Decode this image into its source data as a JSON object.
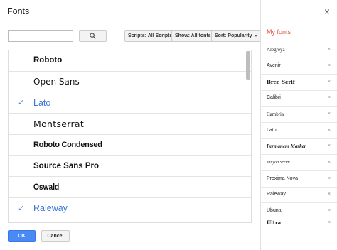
{
  "dialog": {
    "title": "Fonts",
    "close_icon": "×"
  },
  "search": {
    "value": "",
    "placeholder": ""
  },
  "filters": [
    {
      "label": "Scripts: All Scripts"
    },
    {
      "label": "Show: All fonts"
    },
    {
      "label": "Sort: Popularity"
    }
  ],
  "fonts": [
    {
      "name": "Roboto",
      "selected": false
    },
    {
      "name": "Open Sans",
      "selected": false
    },
    {
      "name": "Lato",
      "selected": true
    },
    {
      "name": "Montserrat",
      "selected": false
    },
    {
      "name": "Roboto Condensed",
      "selected": false
    },
    {
      "name": "Source Sans Pro",
      "selected": false
    },
    {
      "name": "Oswald",
      "selected": false
    },
    {
      "name": "Raleway",
      "selected": true
    }
  ],
  "check_icon": "✓",
  "my_fonts": {
    "title": "My fonts",
    "items": [
      {
        "name": "Alegreya"
      },
      {
        "name": "Avenir"
      },
      {
        "name": "Bree Serif"
      },
      {
        "name": "Calibri"
      },
      {
        "name": "Cambria"
      },
      {
        "name": "Lato"
      },
      {
        "name": "Permanent Marker"
      },
      {
        "name": "Pinyon Script"
      },
      {
        "name": "Proxima Nova"
      },
      {
        "name": "Raleway"
      },
      {
        "name": "Ubuntu"
      },
      {
        "name": "Ultra"
      }
    ],
    "remove_icon": "×"
  },
  "buttons": {
    "ok": "OK",
    "cancel": "Cancel"
  },
  "colors": {
    "accent": "#3c78d8",
    "primary_button": "#4a8af4",
    "my_fonts_title": "#e0533d"
  }
}
